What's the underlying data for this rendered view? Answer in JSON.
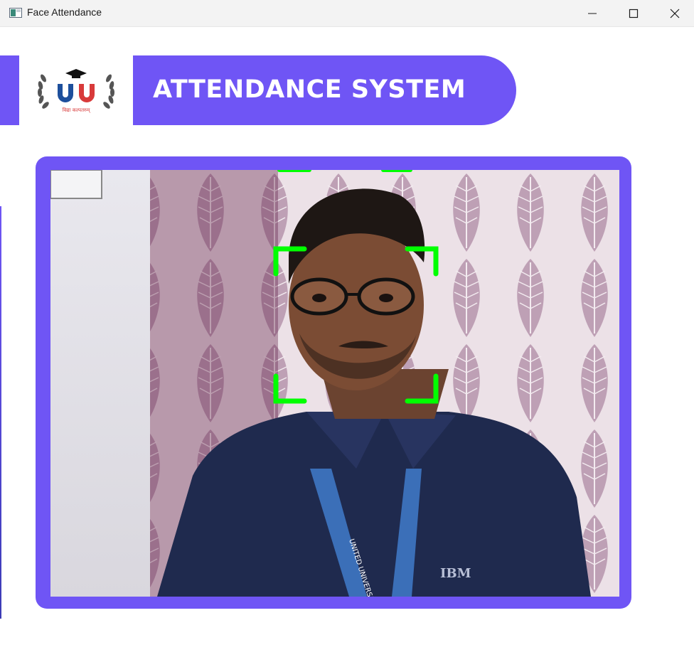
{
  "window": {
    "title": "Face Attendance",
    "controls": [
      "minimize",
      "maximize",
      "close"
    ]
  },
  "header": {
    "logo_caption": "विद्या कल्पतरुम्",
    "logo_letters": "UU",
    "title": "ATTENDANCE SYSTEM"
  },
  "webcam": {
    "lanyard_text": "UNITED UNIVERSITY",
    "shirt_logo": "IBM"
  },
  "colors": {
    "accent": "#6f55f5",
    "detection": "#00ff00"
  }
}
